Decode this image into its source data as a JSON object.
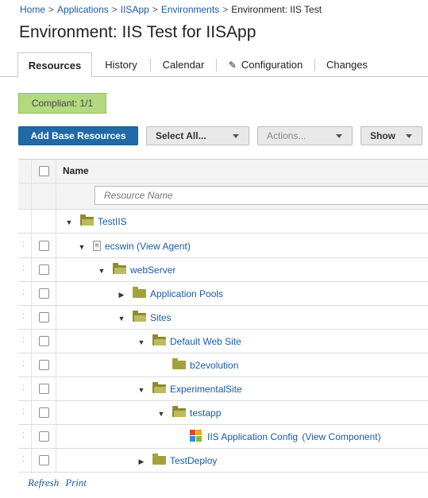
{
  "breadcrumb": {
    "items": [
      "Home",
      "Applications",
      "IISApp",
      "Environments"
    ],
    "current": "Environment: IIS Test",
    "separator": ">"
  },
  "page_title": "Environment: IIS Test for IISApp",
  "tabs": [
    {
      "label": "Resources",
      "active": true
    },
    {
      "label": "History"
    },
    {
      "label": "Calendar"
    },
    {
      "label": "Configuration",
      "icon": "wrench-icon"
    },
    {
      "label": "Changes"
    }
  ],
  "compliance": {
    "label": "Compliant: 1/1",
    "color": "#b3d97f"
  },
  "toolbar": {
    "add_base_resources": "Add Base Resources",
    "select_all": "Select All...",
    "actions": "Actions...",
    "show": "Show"
  },
  "table": {
    "header_name": "Name",
    "filter_placeholder": "Resource Name",
    "rows": [
      {
        "label": "TestIIS",
        "icon": "folder-open-icon",
        "toggle": "expanded",
        "depth": 0
      },
      {
        "label": "ecswin",
        "icon": "agent-icon",
        "toggle": "expanded",
        "depth": 1,
        "link_text": "View Agent"
      },
      {
        "label": "webServer",
        "icon": "folder-open-icon",
        "toggle": "expanded",
        "depth": 2
      },
      {
        "label": "Application Pools",
        "icon": "folder-closed-icon",
        "toggle": "collapsed",
        "depth": 3
      },
      {
        "label": "Sites",
        "icon": "folder-open-icon",
        "toggle": "expanded",
        "depth": 3
      },
      {
        "label": "Default Web Site",
        "icon": "folder-open-icon",
        "toggle": "expanded",
        "depth": 4
      },
      {
        "label": "b2evolution",
        "icon": "folder-closed-icon",
        "toggle": "none",
        "depth": 5
      },
      {
        "label": "ExperimentalSite",
        "icon": "folder-open-icon",
        "toggle": "expanded",
        "depth": 4
      },
      {
        "label": "testapp",
        "icon": "folder-open-icon",
        "toggle": "expanded",
        "depth": 5
      },
      {
        "label": "IIS Application Config",
        "icon": "component-icon",
        "toggle": "none",
        "depth": 6,
        "link_text": "View Component"
      },
      {
        "label": "TestDeploy",
        "icon": "folder-closed-icon",
        "toggle": "collapsed",
        "depth": 4
      }
    ]
  },
  "footer": {
    "refresh": "Refresh",
    "print": "Print"
  },
  "colors": {
    "primary": "#1f6aa7",
    "link": "#1b5aa6",
    "folder": "#8a8a32",
    "compliant": "#b3d97f"
  }
}
